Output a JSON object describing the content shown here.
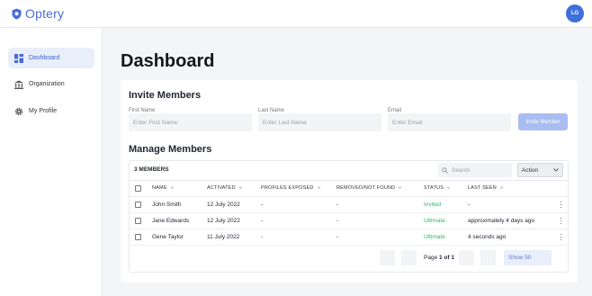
{
  "app": {
    "name": "Optery",
    "user_initials": "LG"
  },
  "sidebar": {
    "items": [
      {
        "label": "Dashboard",
        "icon": "dashboard-icon",
        "active": true
      },
      {
        "label": "Organization",
        "icon": "bank-icon",
        "active": false
      },
      {
        "label": "My Profile",
        "icon": "gear-icon",
        "active": false
      }
    ]
  },
  "page": {
    "title": "Dashboard"
  },
  "invite": {
    "title": "Invite Members",
    "first_name_label": "First Name",
    "first_name_placeholder": "Enter First Name",
    "last_name_label": "Last Name",
    "last_name_placeholder": "Enter Last Name",
    "email_label": "Email",
    "email_placeholder": "Enter Email",
    "button_label": "Invite Member"
  },
  "manage": {
    "title": "Manage Members",
    "count_label": "3 MEMBERS",
    "search_placeholder": "Search",
    "action_label": "Action",
    "columns": [
      "NAME",
      "ACTIVATED",
      "PROFILES EXPOSED",
      "REMOVED/NOT FOUND",
      "STATUS",
      "LAST SEEN"
    ],
    "rows": [
      {
        "name": "John Smith",
        "activated": "12 July 2022",
        "profiles_exposed": "-",
        "removed": "-",
        "status": "Invited",
        "last_seen": "-"
      },
      {
        "name": "Jane Edwards",
        "activated": "12 July 2022",
        "profiles_exposed": "-",
        "removed": "-",
        "status": "Ultimate",
        "last_seen": "approximately 4 days ago"
      },
      {
        "name": "Gene Taylor",
        "activated": "11 July 2022",
        "profiles_exposed": "-",
        "removed": "-",
        "status": "Ultimate",
        "last_seen": "4 seconds ago"
      }
    ],
    "pagination": {
      "page_prefix": "Page ",
      "page_current": "1",
      "page_mid": " of ",
      "page_total": "1",
      "show_label": "Show 50"
    }
  },
  "colors": {
    "accent": "#3f6fd9",
    "status_green": "#2fb86c",
    "invite_button": "#a9bdf0"
  }
}
